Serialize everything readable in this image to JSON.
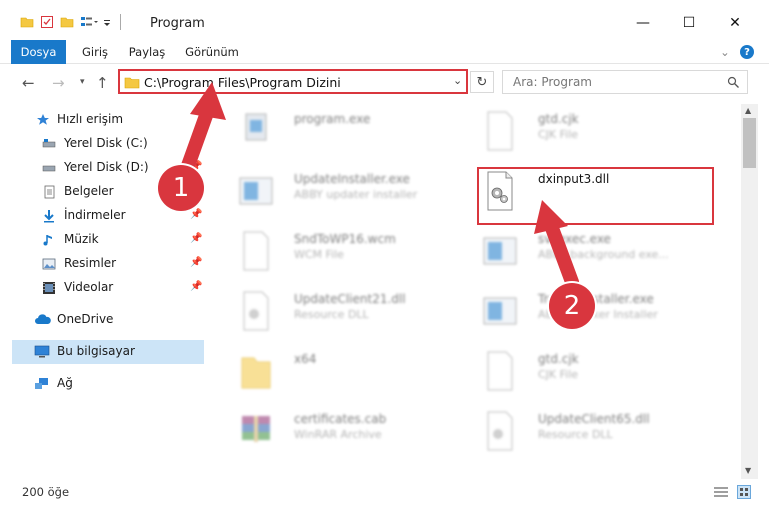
{
  "window": {
    "title": "Program",
    "minimize": "—",
    "maximize": "☐",
    "close": "✕"
  },
  "ribbon": {
    "tabs": [
      "Dosya",
      "Giriş",
      "Paylaş",
      "Görünüm"
    ],
    "expand": "⌄",
    "help": "?"
  },
  "address": {
    "path": "C:\\Program Files\\Program Dizini",
    "search_placeholder": "Ara: Program"
  },
  "nav": {
    "items": [
      {
        "label": "Hızlı erişim",
        "icon": "star-icon"
      },
      {
        "label": "Yerel Disk (C:)",
        "icon": "drive-icon"
      },
      {
        "label": "Yerel Disk (D:)",
        "icon": "drive-icon"
      },
      {
        "label": "Belgeler",
        "icon": "documents-icon"
      },
      {
        "label": "İndirmeler",
        "icon": "download-icon"
      },
      {
        "label": "Müzik",
        "icon": "music-icon"
      },
      {
        "label": "Resimler",
        "icon": "pictures-icon"
      },
      {
        "label": "Videolar",
        "icon": "video-icon"
      },
      {
        "label": "OneDrive",
        "icon": "cloud-icon"
      },
      {
        "label": "Bu bilgisayar",
        "icon": "computer-icon"
      },
      {
        "label": "Ağ",
        "icon": "network-icon"
      }
    ]
  },
  "files": [
    {
      "name": "program.exe",
      "desc": ""
    },
    {
      "name": "gtd.cjk",
      "desc": "CJK File"
    },
    {
      "name": "UpdateInstaller.exe",
      "desc": "ABBY updater installer"
    },
    {
      "name": "dxinput3.dll",
      "desc": ""
    },
    {
      "name": "SndToWP16.wcm",
      "desc": "WCM File"
    },
    {
      "name": "svcexec.exe",
      "desc": "ABBY background exe..."
    },
    {
      "name": "UpdateClient21.dll",
      "desc": "Resource DLL"
    },
    {
      "name": "TrackerInstaller.exe",
      "desc": "ABBY Tracker Installer"
    },
    {
      "name": "x64",
      "desc": ""
    },
    {
      "name": "gtd.cjk",
      "desc": "CJK File"
    },
    {
      "name": "certificates.cab",
      "desc": "WinRAR Archive"
    },
    {
      "name": "UpdateClient65.dll",
      "desc": "Resource DLL"
    }
  ],
  "status": {
    "count": "200 öğe"
  },
  "badges": {
    "one": "1",
    "two": "2"
  },
  "colors": {
    "accent": "#1979ca",
    "highlight": "#d9363e"
  }
}
